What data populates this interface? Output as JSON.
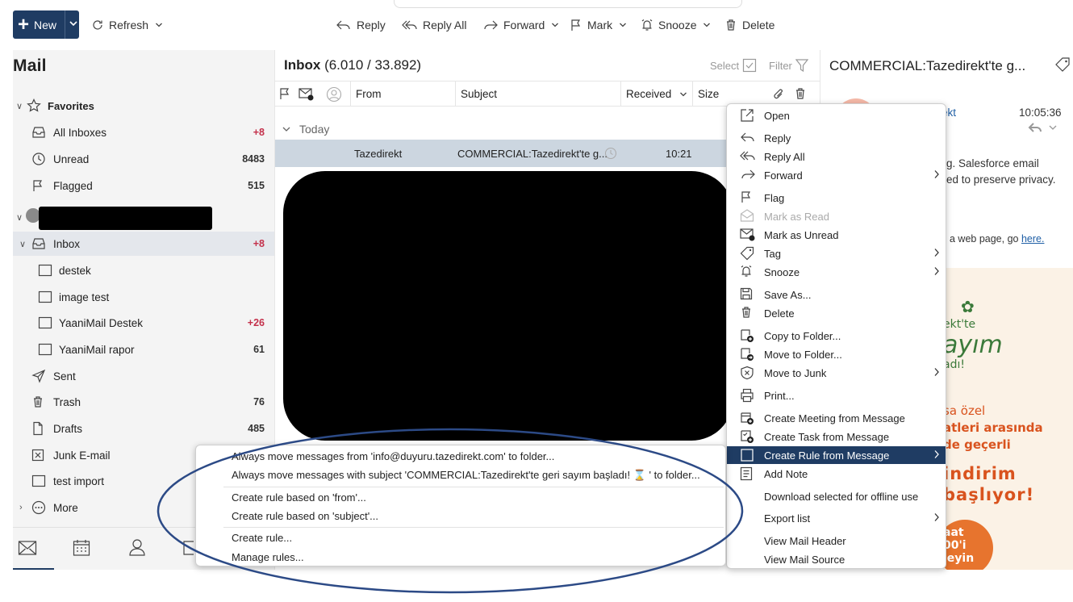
{
  "toolbar": {
    "new_label": "New",
    "refresh_label": "Refresh",
    "reply_label": "Reply",
    "reply_all_label": "Reply All",
    "forward_label": "Forward",
    "mark_label": "Mark",
    "snooze_label": "Snooze",
    "delete_label": "Delete"
  },
  "nav": {
    "title": "Mail",
    "favorites_label": "Favorites",
    "favorites": [
      {
        "label": "All Inboxes",
        "count": "+8"
      },
      {
        "label": "Unread",
        "count": "8483"
      },
      {
        "label": "Flagged",
        "count": "515"
      }
    ],
    "inbox": {
      "label": "Inbox",
      "count": "+8"
    },
    "subfolders": [
      {
        "label": "destek",
        "count": ""
      },
      {
        "label": "image test",
        "count": ""
      },
      {
        "label": "YaaniMail Destek",
        "count": "+26"
      },
      {
        "label": "YaaniMail rapor",
        "count": "61"
      }
    ],
    "folders": [
      {
        "label": "Sent",
        "count": ""
      },
      {
        "label": "Trash",
        "count": "76"
      },
      {
        "label": "Drafts",
        "count": "485"
      },
      {
        "label": "Junk E-mail",
        "count": ""
      },
      {
        "label": "test import",
        "count": ""
      },
      {
        "label": "More",
        "count": ""
      }
    ]
  },
  "list": {
    "title_bold": "Inbox",
    "title_counts": " (6.010 / 33.892)",
    "select_label": "Select",
    "filter_label": "Filter",
    "columns": {
      "from": "From",
      "subject": "Subject",
      "received": "Received",
      "size": "Size"
    },
    "group_label": "Today",
    "message": {
      "from": "Tazedirekt",
      "subject": "COMMERCIAL:Tazedirekt'te g...",
      "time": "10:21"
    }
  },
  "reading": {
    "title": "COMMERCIAL:Tazedirekt'te g...",
    "sender_fragment": "ekt",
    "time": "10:05:36",
    "line1": "g. Salesforce email",
    "line2": "ed to preserve privacy.",
    "line3_prefix": "a web page, go ",
    "line3_link": "here.",
    "banner": {
      "l1": "ekt'te",
      "l2": "ayım",
      "l3": "adı!",
      "l4": "sa özel",
      "l5": "atleri arasında",
      "l6": "de geçerli",
      "l7": "indirim",
      "l8": "başlıyor!",
      "l9": "aat",
      "l10": "00'i",
      "l11": "leyin"
    }
  },
  "context_menu": {
    "items": [
      {
        "label": "Open"
      },
      {
        "label": "Reply"
      },
      {
        "label": "Reply All"
      },
      {
        "label": "Forward"
      },
      {
        "label": "Flag"
      },
      {
        "label": "Mark as Read"
      },
      {
        "label": "Mark as Unread"
      },
      {
        "label": "Tag"
      },
      {
        "label": "Snooze"
      },
      {
        "label": "Save As..."
      },
      {
        "label": "Delete"
      },
      {
        "label": "Copy to Folder..."
      },
      {
        "label": "Move to Folder..."
      },
      {
        "label": "Move to Junk"
      },
      {
        "label": "Print..."
      },
      {
        "label": "Create Meeting from Message"
      },
      {
        "label": "Create Task from Message"
      },
      {
        "label": "Create Rule from Message"
      },
      {
        "label": "Add Note"
      },
      {
        "label": "Download selected for offline use"
      },
      {
        "label": "Export list"
      },
      {
        "label": "View Mail Header"
      },
      {
        "label": "View Mail Source"
      }
    ]
  },
  "rule_submenu": {
    "items": [
      {
        "label": "Always move messages from 'info@duyuru.tazedirekt.com' to folder..."
      },
      {
        "label": "Always move messages with subject 'COMMERCIAL:Tazedirekt'te geri sayım başladı! ⌛ ' to folder..."
      },
      {
        "label": "Create rule based on 'from'..."
      },
      {
        "label": "Create rule based on 'subject'..."
      },
      {
        "label": "Create rule..."
      },
      {
        "label": "Manage rules..."
      }
    ]
  },
  "colors": {
    "accent": "#1f3c63",
    "selection": "#ccd6e0",
    "unread_count": "#c4314b",
    "annotation": "#2c4a86"
  }
}
